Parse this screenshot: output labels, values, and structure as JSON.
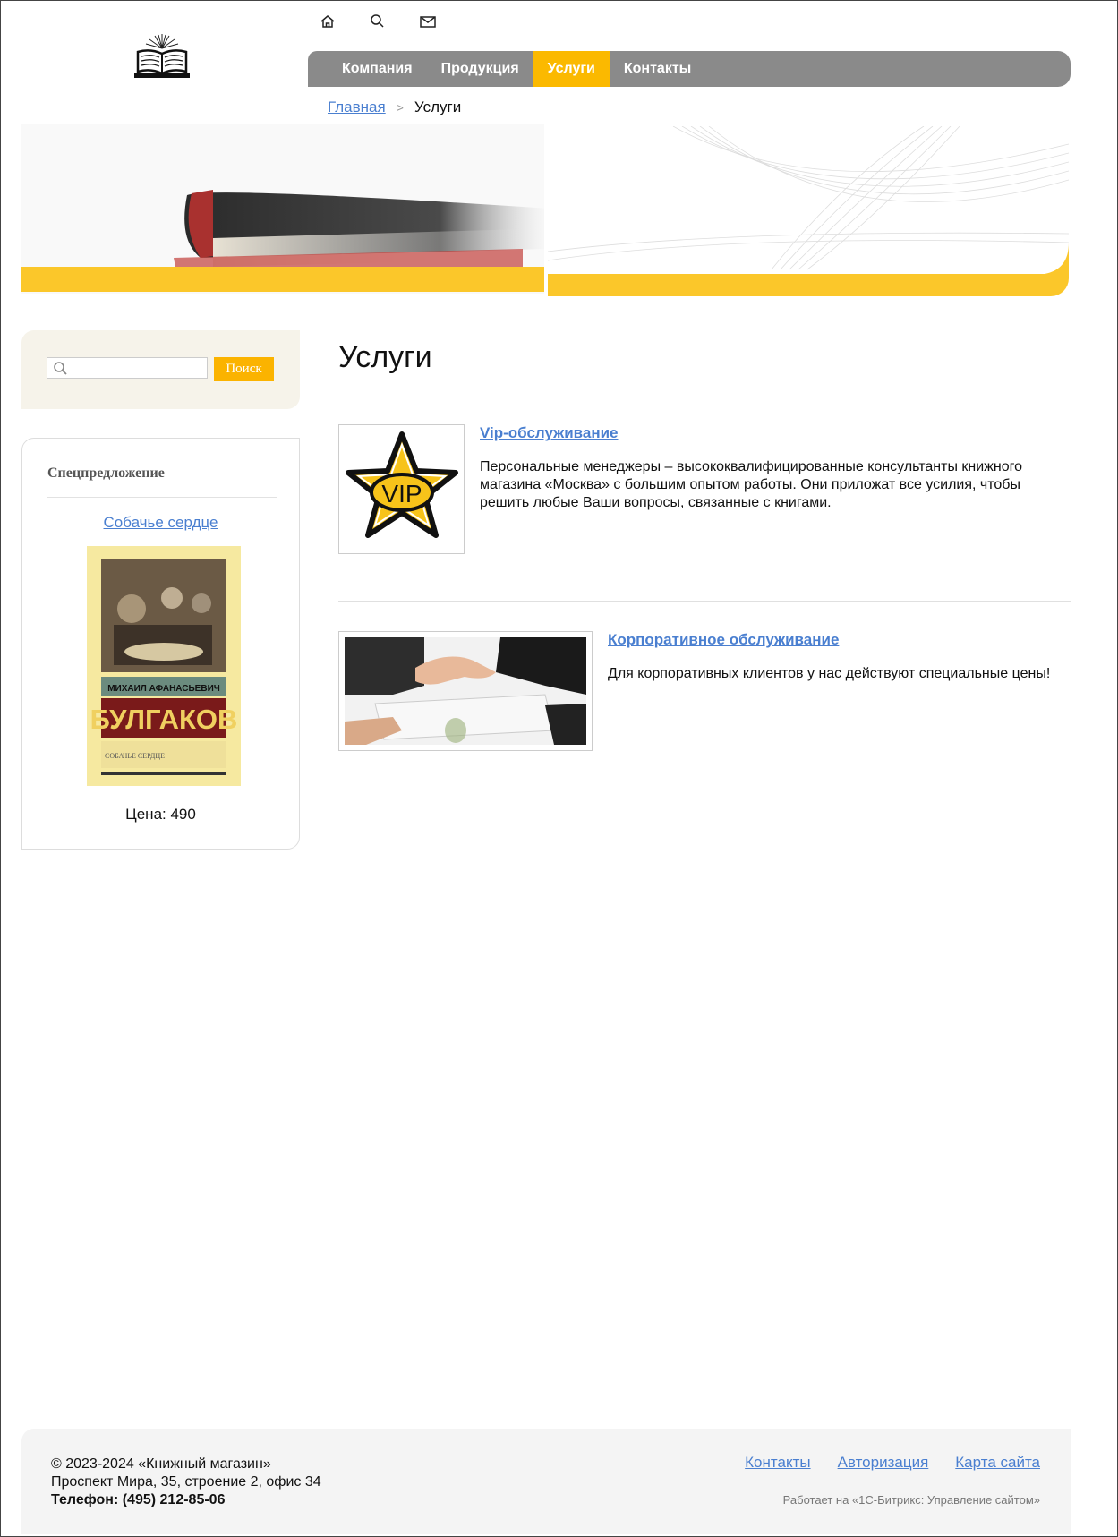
{
  "header": {
    "icons": [
      "home-icon",
      "search-icon",
      "mail-icon"
    ],
    "nav": [
      {
        "label": "Компания",
        "active": false
      },
      {
        "label": "Продукция",
        "active": false
      },
      {
        "label": "Услуги",
        "active": true
      },
      {
        "label": "Контакты",
        "active": false
      }
    ],
    "accent_color": "#fbb900",
    "nav_color": "#8a8a8a"
  },
  "breadcrumb": {
    "home": "Главная",
    "current": "Услуги"
  },
  "sidebar": {
    "search": {
      "placeholder": "",
      "button": "Поиск"
    },
    "special": {
      "title": "Спецпредложение",
      "book_link": "Собачье сердце",
      "book_cover": {
        "author": "МИХАИЛ АФАНАСЬЕВИЧ",
        "surname": "БУЛГАКОВ",
        "title": "СОБАЧЬЕ СЕРДЦЕ"
      },
      "price": "Цена: 490"
    }
  },
  "main": {
    "title": "Услуги",
    "items": [
      {
        "title": "Vip-обслуживание",
        "image_text": "VIP",
        "description": "Персональные менеджеры – высококвалифицированные консультанты книжного магазина «Москва» с большим опытом работы. Они приложат все усилия, чтобы решить любые Ваши вопросы, связанные с книгами."
      },
      {
        "title": "Корпоративное обслуживание",
        "description": "Для корпоративных клиентов у нас действуют специальные цены!"
      }
    ]
  },
  "footer": {
    "copyright": "© 2023-2024 «Книжный магазин»",
    "address": "Проспект Мира, 35, строение 2, офис 34",
    "phone": "Телефон: (495) 212-85-06",
    "links": [
      "Контакты",
      "Авторизация",
      "Карта сайта"
    ],
    "powered": "Работает на «1С-Битрикс: Управление сайтом»"
  }
}
